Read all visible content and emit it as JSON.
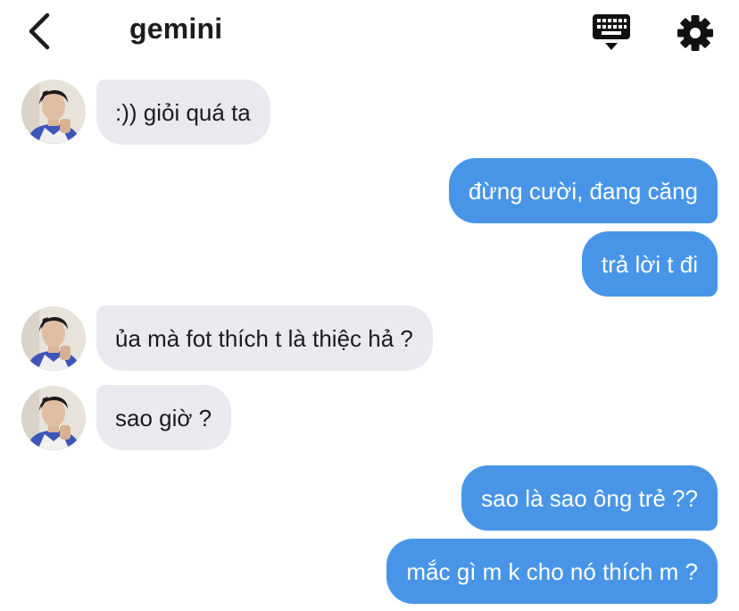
{
  "header": {
    "title": "gemini",
    "back_icon": "chevron-left-icon",
    "keyboard_icon": "keyboard-icon",
    "settings_icon": "gear-icon"
  },
  "colors": {
    "incoming_bubble": "#e8eaef",
    "outgoing_bubble": "#4895e8",
    "text_dark": "#1c1c1e",
    "text_light": "#ffffff"
  },
  "messages": [
    {
      "sender": "them",
      "text": ":)) giỏi quá ta"
    },
    {
      "sender": "me",
      "text": "đừng cười, đang căng"
    },
    {
      "sender": "me",
      "text": "trả lời t đi"
    },
    {
      "sender": "them",
      "text": "ủa mà fot thích t là thiệc hả ?"
    },
    {
      "sender": "them",
      "text": "sao giờ ?"
    },
    {
      "sender": "me",
      "text": "sao là sao ông trẻ ??"
    },
    {
      "sender": "me",
      "text": "mắc gì m k cho nó thích m ?"
    }
  ]
}
